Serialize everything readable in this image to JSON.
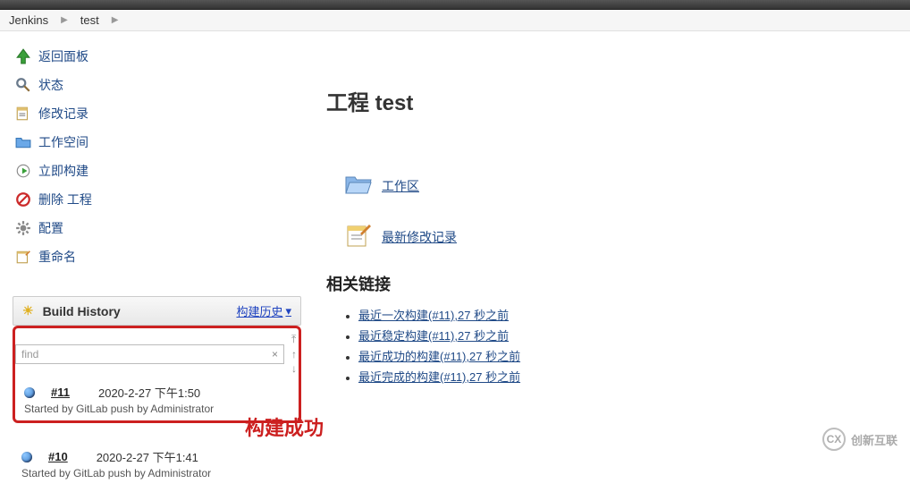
{
  "breadcrumb": {
    "root": "Jenkins",
    "project": "test"
  },
  "sidebar": {
    "items": [
      {
        "label": "返回面板"
      },
      {
        "label": "状态"
      },
      {
        "label": "修改记录"
      },
      {
        "label": "工作空间"
      },
      {
        "label": "立即构建"
      },
      {
        "label": "删除 工程"
      },
      {
        "label": "配置"
      },
      {
        "label": "重命名"
      }
    ]
  },
  "build_history": {
    "title": "Build History",
    "trend_label": "构建历史",
    "find_placeholder": "find",
    "builds": [
      {
        "num": "#11",
        "time": "2020-2-27 下午1:50",
        "started": "Started by GitLab push by Administrator"
      },
      {
        "num": "#10",
        "time": "2020-2-27 下午1:41",
        "started": "Started by GitLab push by Administrator"
      }
    ],
    "annotation": "构建成功"
  },
  "main": {
    "title_prefix": "工程 ",
    "title_name": "test",
    "workspace_link": "工作区",
    "recent_changes_link": "最新修改记录",
    "related_heading": "相关链接",
    "related": [
      "最近一次构建(#11),27 秒之前",
      "最近稳定构建(#11),27 秒之前",
      "最近成功的构建(#11),27 秒之前",
      "最近完成的构建(#11),27 秒之前"
    ]
  },
  "watermark": "创新互联"
}
